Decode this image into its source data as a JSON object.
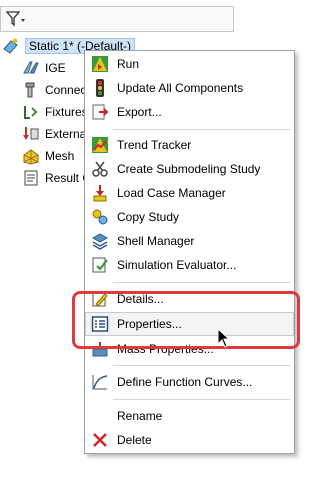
{
  "tree": {
    "study": {
      "label": "Static 1* (-Default-)"
    },
    "items": [
      {
        "label": "IGE",
        "icon": "part-icon"
      },
      {
        "label": "Connec",
        "icon": "connections-icon"
      },
      {
        "label": "Fixtures",
        "icon": "fixtures-icon"
      },
      {
        "label": "Externa",
        "icon": "external-loads-icon"
      },
      {
        "label": "Mesh",
        "icon": "mesh-icon"
      },
      {
        "label": "Result C",
        "icon": "result-options-icon"
      }
    ]
  },
  "menu": {
    "items": [
      {
        "label": "Run",
        "icon": "run-icon"
      },
      {
        "label": "Update All Components",
        "icon": "traffic-light-icon"
      },
      {
        "label": "Export...",
        "icon": "export-icon"
      },
      {
        "label": "Trend Tracker",
        "icon": "trend-tracker-icon"
      },
      {
        "label": "Create Submodeling Study",
        "icon": "scissors-icon"
      },
      {
        "label": "Load Case Manager",
        "icon": "load-case-icon"
      },
      {
        "label": "Copy Study",
        "icon": "copy-study-icon"
      },
      {
        "label": "Shell Manager",
        "icon": "shell-manager-icon"
      },
      {
        "label": "Simulation Evaluator...",
        "icon": "evaluator-icon"
      },
      {
        "label": "Details...",
        "icon": "details-icon"
      },
      {
        "label": "Properties...",
        "icon": "properties-icon"
      },
      {
        "label": "Mass Properties...",
        "icon": "mass-properties-icon"
      },
      {
        "label": "Define Function Curves...",
        "icon": "function-curve-icon"
      },
      {
        "label": "Rename",
        "icon": ""
      },
      {
        "label": "Delete",
        "icon": "delete-icon"
      }
    ]
  },
  "colors": {
    "highlight": "#e03a3a",
    "selection": "#cfe3f7"
  }
}
